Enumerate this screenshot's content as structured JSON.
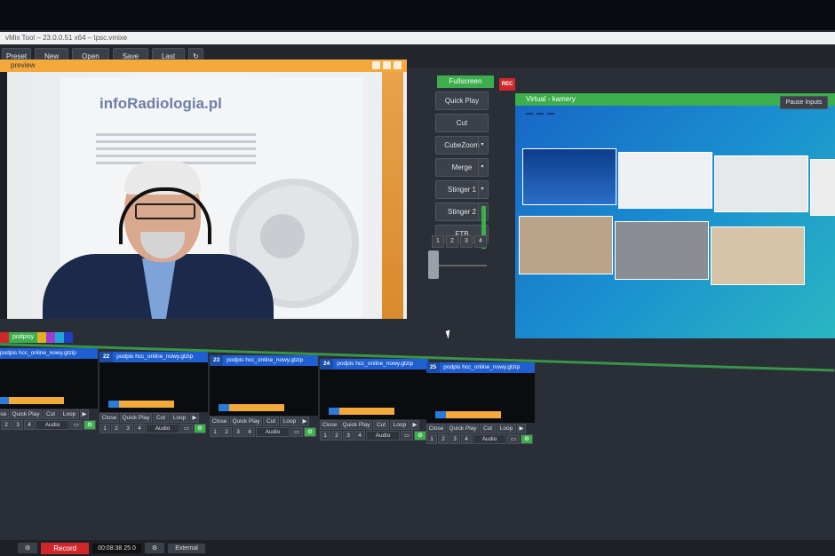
{
  "window": {
    "title": "vMix Tool – 23.0.0.51 x64 – tpsc.vmixe"
  },
  "toolbar": {
    "left_label": "Preset",
    "new_label": "New",
    "open_label": "Open",
    "save_label": "Save",
    "last_label": "Last"
  },
  "preview": {
    "header": "preview"
  },
  "preview_video": {
    "logo": "infoRadiologia.pl"
  },
  "transitions": {
    "fullscreen_label": "Fullscreen",
    "rec_label": "REC",
    "buttons": [
      "Quick Play",
      "Cut",
      "CubeZoom",
      "Merge",
      "Stinger 1",
      "Stinger 2",
      "FTB"
    ],
    "numbers": [
      "1",
      "2",
      "3",
      "4"
    ]
  },
  "output": {
    "header": "Virtual - kamery",
    "pause_label": "Pause Inputs"
  },
  "inputs_bar": {
    "tab_label": "podpisy"
  },
  "inputs": [
    {
      "number": "",
      "name": "podpis hcc_online_nowy.gtzip"
    },
    {
      "number": "22",
      "name": "podpis hcc_online_nowy.gtzip"
    },
    {
      "number": "23",
      "name": "podpis hcc_online_nowy.gtzip"
    },
    {
      "number": "24",
      "name": "podpis hcc_online_nowy.gtzip"
    },
    {
      "number": "25",
      "name": "podpis hcc_online_nowy.gtzip"
    }
  ],
  "input_controls": {
    "close": "Close",
    "quick_play": "Quick Play",
    "cut": "Cut",
    "loop": "Loop",
    "audio": "Audio",
    "nums": [
      "1",
      "2",
      "3",
      "4"
    ]
  },
  "bottom": {
    "record_label": "Record",
    "timecode": "00:08:38 25 0",
    "external_label": "External"
  }
}
